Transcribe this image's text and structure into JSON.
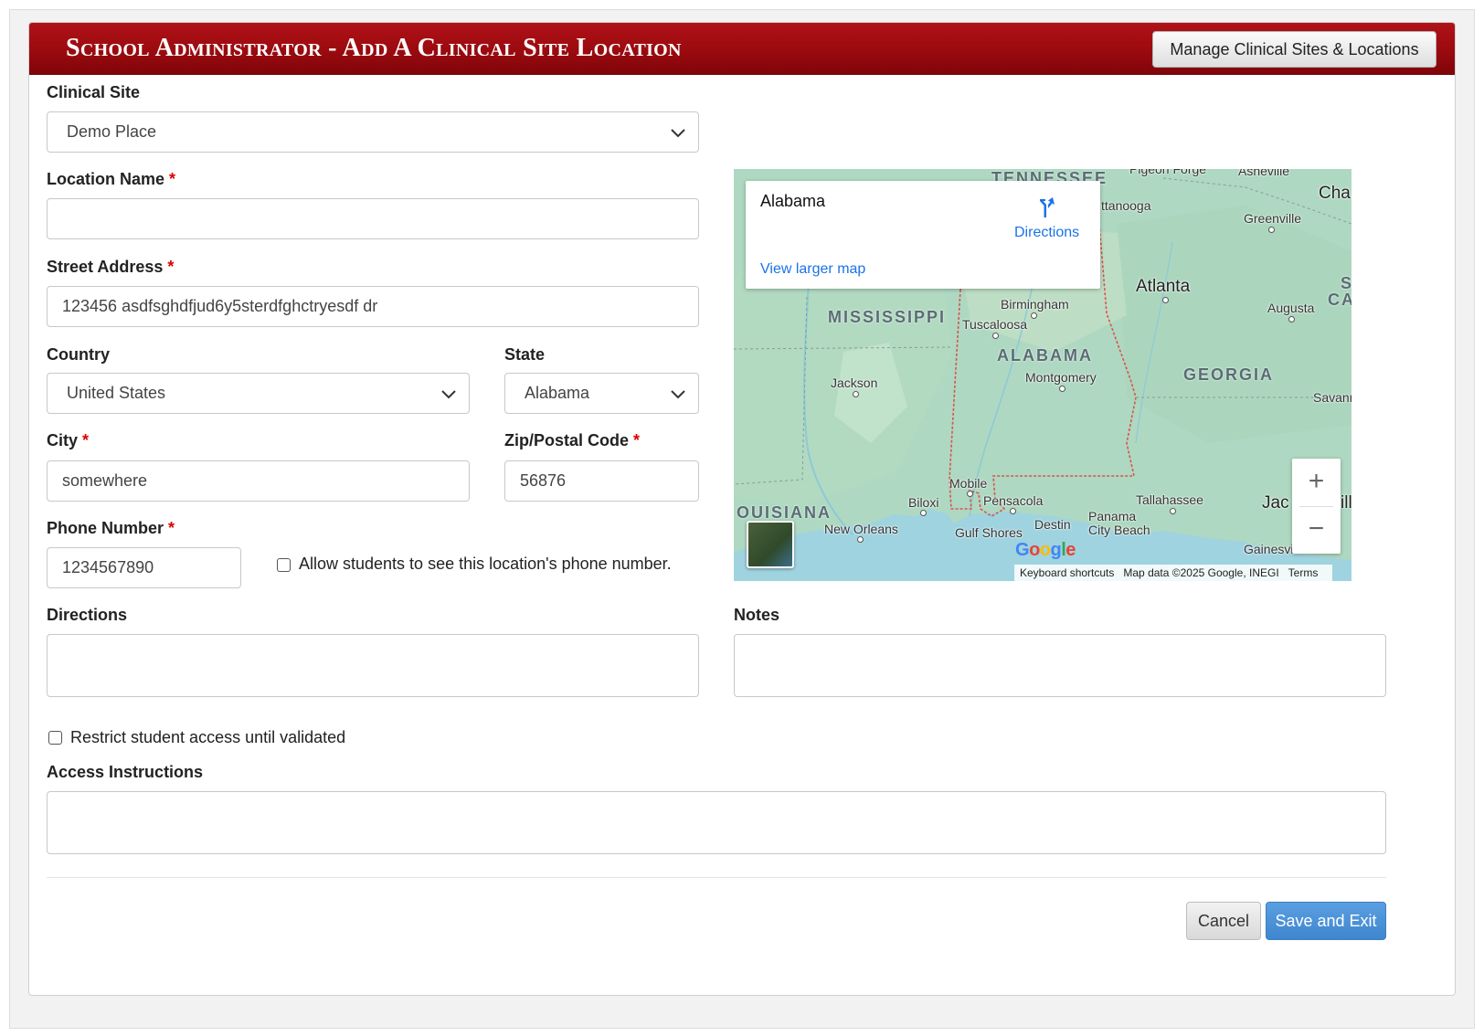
{
  "header": {
    "title": "School Administrator - Add A Clinical Site Location",
    "manage_button": "Manage Clinical Sites & Locations"
  },
  "form": {
    "clinical_site": {
      "label": "Clinical Site",
      "value": "Demo Place"
    },
    "location_name": {
      "label": "Location Name",
      "required_mark": "*",
      "value": ""
    },
    "street_address": {
      "label": "Street Address",
      "required_mark": "*",
      "value": "123456 asdfsghdfjud6y5sterdfghctryesdf dr"
    },
    "country": {
      "label": "Country",
      "value": "United States"
    },
    "state": {
      "label": "State",
      "value": "Alabama"
    },
    "city": {
      "label": "City",
      "required_mark": "*",
      "value": "somewhere"
    },
    "zip": {
      "label": "Zip/Postal Code",
      "required_mark": "*",
      "value": "56876"
    },
    "phone": {
      "label": "Phone Number",
      "required_mark": "*",
      "value": "1234567890"
    },
    "phone_visibility": {
      "label": "Allow students to see this location's phone number.",
      "checked": false
    },
    "directions": {
      "label": "Directions",
      "value": ""
    },
    "notes": {
      "label": "Notes",
      "value": ""
    },
    "restrict_access": {
      "label": "Restrict student access until validated",
      "checked": false
    },
    "access_instructions": {
      "label": "Access Instructions",
      "value": ""
    }
  },
  "map": {
    "info_title": "Alabama",
    "directions_link": "Directions",
    "larger_map_link": "View larger map",
    "states": {
      "tennessee": "TENNESSEE",
      "mississippi": "MISSISSIPPI",
      "alabama": "ALABAMA",
      "georgia": "GEORGIA",
      "louisiana": "OUISIANA",
      "south_carolina_1": "S",
      "south_carolina_2": "CA"
    },
    "cities": {
      "atlanta": "Atlanta",
      "birmingham": "Birmingham",
      "tuscaloosa": "Tuscaloosa",
      "montgomery": "Montgomery",
      "jackson": "Jackson",
      "chattanooga": "ttanooga",
      "greenville": "Greenville",
      "augusta": "Augusta",
      "savannah": "Savann",
      "mobile": "Mobile",
      "pensacola": "Pensacola",
      "biloxi": "Biloxi",
      "new_orleans": "New Orleans",
      "gulf_shores": "Gulf Shores",
      "destin": "Destin",
      "panama_city": "Panama City Beach",
      "tallahassee": "Tallahassee",
      "jacksonville_1": "Jac",
      "jacksonville_2": "ill",
      "gainesville": "Gainesvi",
      "charlotte": "Cha",
      "asheville": "Asheville",
      "pigeon_forge": "Pigeon Forge"
    },
    "zoom_in": "+",
    "zoom_out": "−",
    "google_logo": "Google",
    "keyboard_shortcuts": "Keyboard shortcuts",
    "map_data": "Map data ©2025 Google, INEGI",
    "terms": "Terms"
  },
  "actions": {
    "cancel": "Cancel",
    "save": "Save and Exit"
  },
  "colors": {
    "header_red": "#9a0a0f",
    "save_blue": "#3f86cf",
    "required_red": "#dd0000",
    "link_blue": "#1a73e8"
  }
}
